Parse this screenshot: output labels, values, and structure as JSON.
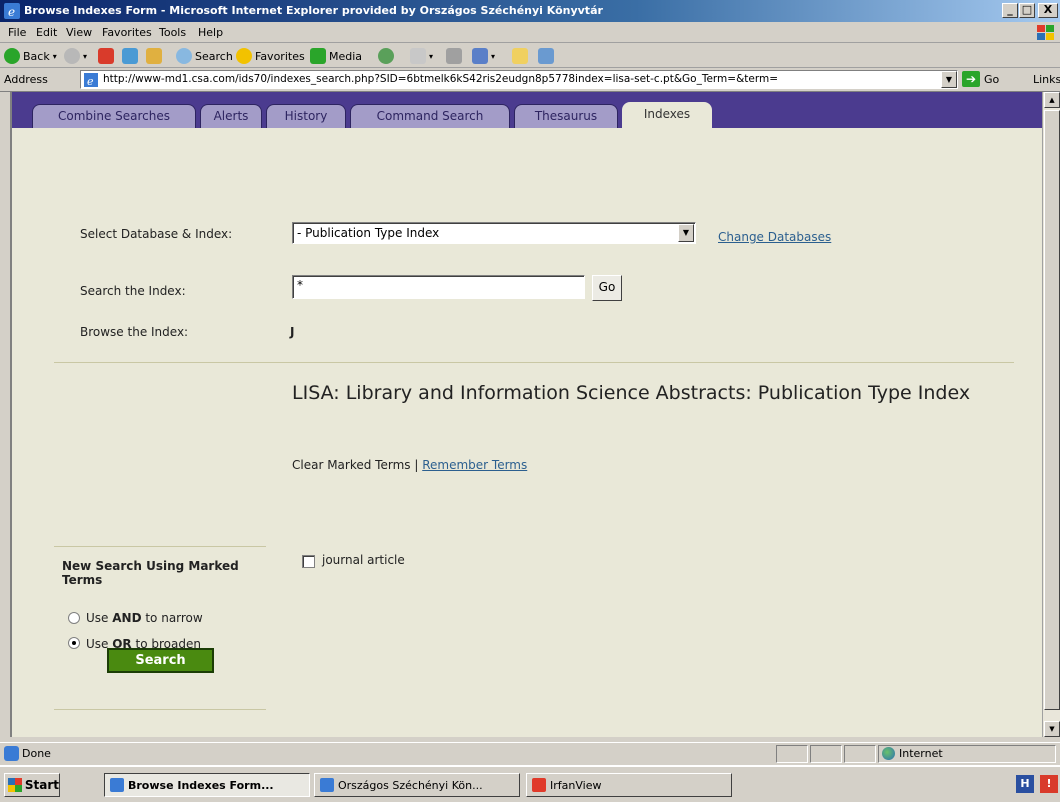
{
  "window": {
    "title": "Browse Indexes Form - Microsoft Internet Explorer provided by Országos Széchényi Könyvtár",
    "controls": {
      "minimize": "_",
      "maximize": "□",
      "close": "X"
    }
  },
  "menubar": {
    "items": [
      "File",
      "Edit",
      "View",
      "Favorites",
      "Tools",
      "Help"
    ]
  },
  "toolbar": {
    "back": "Back",
    "search": "Search",
    "favorites": "Favorites",
    "media": "Media"
  },
  "addressbar": {
    "label": "Address",
    "url": "http://www-md1.csa.com/ids70/indexes_search.php?SID=6btmelk6kS42ris2eudgn8p5778index=lisa-set-c.pt&Go_Term=&term=",
    "go": "Go",
    "links": "Links"
  },
  "tabs": [
    "Combine Searches",
    "Alerts",
    "History",
    "Command Search",
    "Thesaurus",
    "Indexes"
  ],
  "active_tab": "Indexes",
  "form": {
    "select_label": "Select Database & Index:",
    "select_value": "- Publication Type Index",
    "change_databases": "Change Databases",
    "search_label": "Search the Index:",
    "search_value": "*",
    "go_button": "Go",
    "browse_label": "Browse the Index:",
    "browse_value": "J"
  },
  "results": {
    "title": "LISA: Library and Information Science Abstracts: Publication Type Index",
    "clear_marked": "Clear Marked Terms",
    "separator": "|",
    "remember_terms": "Remember Terms",
    "terms": [
      {
        "label": "journal article",
        "checked": false
      }
    ]
  },
  "new_search": {
    "heading": "New Search Using Marked Terms",
    "options": [
      {
        "prefix": "Use ",
        "bold": "AND",
        "suffix": " to narrow",
        "checked": false
      },
      {
        "prefix": "Use ",
        "bold": "OR",
        "suffix": " to broaden",
        "checked": true
      }
    ],
    "search_button": "Search"
  },
  "statusbar": {
    "status": "Done",
    "zone": "Internet"
  },
  "taskbar": {
    "start": "Start",
    "tasks": [
      {
        "label": "Browse Indexes Form...",
        "active": true
      },
      {
        "label": "Országos Széchényi Kön...",
        "active": false
      },
      {
        "label": "IrfanView",
        "active": false
      }
    ],
    "tray": [
      "H",
      "!"
    ]
  },
  "colors": {
    "titlebar": "#0a246a",
    "tabstrip": "#4b3b8f",
    "tab_inactive": "#a39cc8",
    "content_bg": "#e9e8d8",
    "search_button": "#4a8a10",
    "link": "#2b5f8f"
  }
}
